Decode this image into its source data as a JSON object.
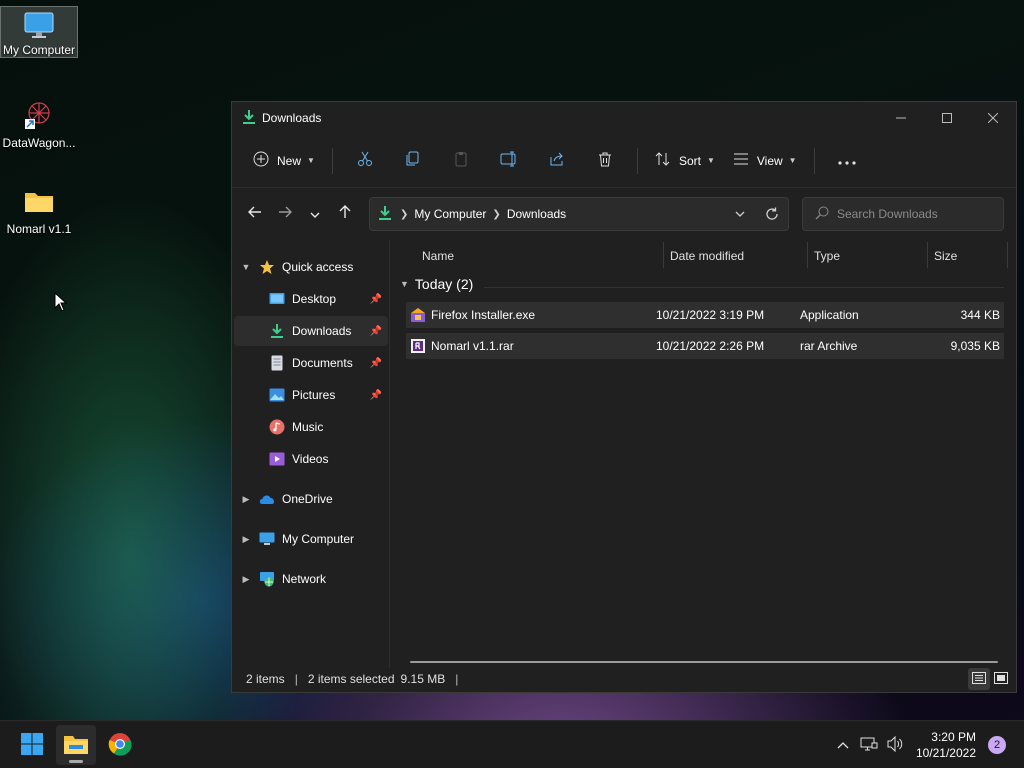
{
  "desktop": {
    "icons": [
      {
        "label": "My Computer",
        "icon": "monitor-icon"
      },
      {
        "label": "DataWagon...",
        "icon": "datawagon-shortcut-icon"
      },
      {
        "label": "Nomarl v1.1",
        "icon": "folder-icon"
      }
    ]
  },
  "window": {
    "title": "Downloads",
    "toolbar": {
      "new_label": "New",
      "sort_label": "Sort",
      "view_label": "View"
    },
    "address": {
      "crumbs": [
        "My Computer",
        "Downloads"
      ]
    },
    "search": {
      "placeholder": "Search Downloads"
    },
    "sidebar": {
      "quick_access": "Quick access",
      "items": [
        {
          "label": "Desktop",
          "pinned": true
        },
        {
          "label": "Downloads",
          "pinned": true,
          "active": true
        },
        {
          "label": "Documents",
          "pinned": true
        },
        {
          "label": "Pictures",
          "pinned": true
        },
        {
          "label": "Music",
          "pinned": false
        },
        {
          "label": "Videos",
          "pinned": false
        }
      ],
      "roots": [
        {
          "label": "OneDrive"
        },
        {
          "label": "My Computer"
        },
        {
          "label": "Network"
        }
      ]
    },
    "columns": [
      "Name",
      "Date modified",
      "Type",
      "Size"
    ],
    "group": {
      "label": "Today (2)"
    },
    "files": [
      {
        "name": "Firefox Installer.exe",
        "date": "10/21/2022 3:19 PM",
        "type": "Application",
        "size": "344 KB"
      },
      {
        "name": "Nomarl v1.1.rar",
        "date": "10/21/2022 2:26 PM",
        "type": "rar Archive",
        "size": "9,035 KB"
      }
    ],
    "status": {
      "items": "2 items",
      "selected": "2 items selected",
      "size": "9.15 MB"
    }
  },
  "taskbar": {
    "time": "3:20 PM",
    "date": "10/21/2022",
    "notifications": "2"
  },
  "colors": {
    "accent_green": "#3ecf8e",
    "window_bg": "#202020",
    "folder_yellow": "#f5c342"
  }
}
